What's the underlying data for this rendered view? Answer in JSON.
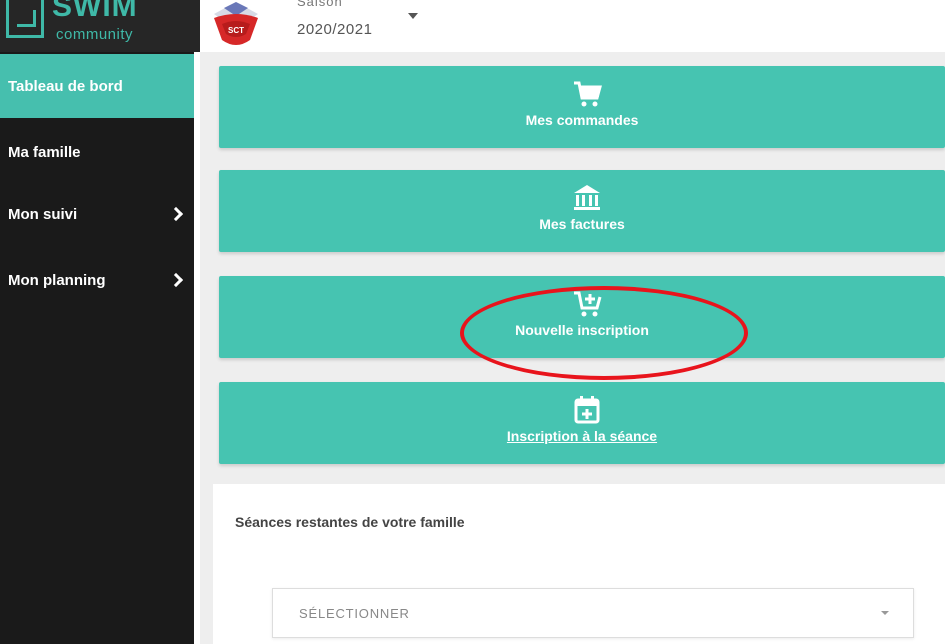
{
  "brand": {
    "name": "SWIM",
    "sub": "community",
    "accent_color": "#46c4b1"
  },
  "header": {
    "season_label_cut": "Saison",
    "season_value": "2020/2021",
    "club_logo_icon": "club-logo-icon"
  },
  "sidebar": {
    "items": [
      {
        "label": "Tableau de bord",
        "active": true,
        "has_chevron": false
      },
      {
        "label": "Ma famille",
        "active": false,
        "has_chevron": false
      },
      {
        "label": "Mon suivi",
        "active": false,
        "has_chevron": true
      },
      {
        "label": "Mon planning",
        "active": false,
        "has_chevron": true
      }
    ]
  },
  "tiles": [
    {
      "label": "Mes commandes",
      "icon": "cart-icon"
    },
    {
      "label": "Mes factures",
      "icon": "bank-icon"
    },
    {
      "label": "Nouvelle inscription",
      "icon": "cart-plus-icon",
      "highlighted": true
    },
    {
      "label": "Inscription à la séance",
      "icon": "calendar-plus-icon"
    }
  ],
  "remaining": {
    "title": "Séances restantes de votre famille",
    "select_placeholder": "SÉLECTIONNER"
  },
  "annotation_color": "#e8141c"
}
